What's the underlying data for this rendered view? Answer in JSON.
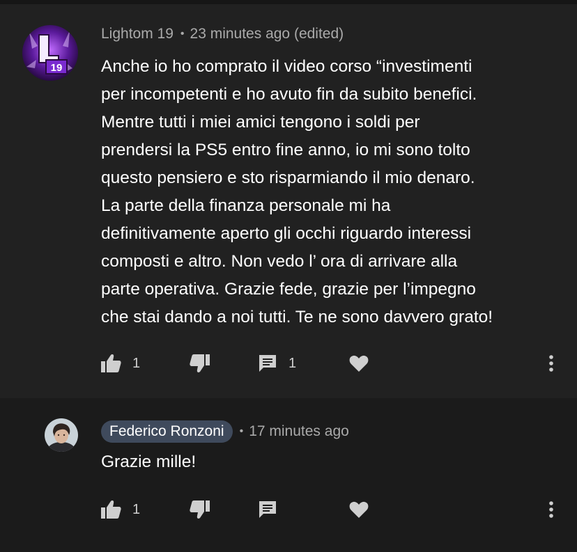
{
  "comments": [
    {
      "author": "Lightom 19",
      "time": "23 minutes ago (edited)",
      "avatar_icon": "purple-logo-avatar",
      "text": "Anche io ho comprato il video corso “investimenti\nper incompetenti e ho avuto fin da subito benefici.\nMentre tutti i miei amici tengono i soldi per\nprendersi la PS5 entro fine anno, io mi sono tolto\nquesto pensiero e sto risparmiando il mio denaro.\nLa parte della finanza personale mi ha\ndefinitivamente aperto gli occhi riguardo interessi\ncomposti e altro. Non vedo l’ ora di arrivare alla\nparte operativa. Grazie fede, grazie per l’impegno\nche stai dando a noi tutti. Te ne sono davvero grato!",
      "likes": "1",
      "replies": "1"
    },
    {
      "author": "Federico Ronzoni",
      "time": "17 minutes ago",
      "avatar_icon": "person-photo-avatar",
      "text": "Grazie mille!",
      "likes": "1"
    }
  ],
  "icons": {
    "like": "thumbs-up-icon",
    "dislike": "thumbs-down-icon",
    "reply": "comment-icon",
    "heart": "heart-icon",
    "more": "more-vertical-icon"
  },
  "colors": {
    "background": "#212121",
    "reply_background": "#1b1b1b",
    "secondary_text": "#aaaaaa",
    "owner_badge": "#3f4a5c"
  }
}
